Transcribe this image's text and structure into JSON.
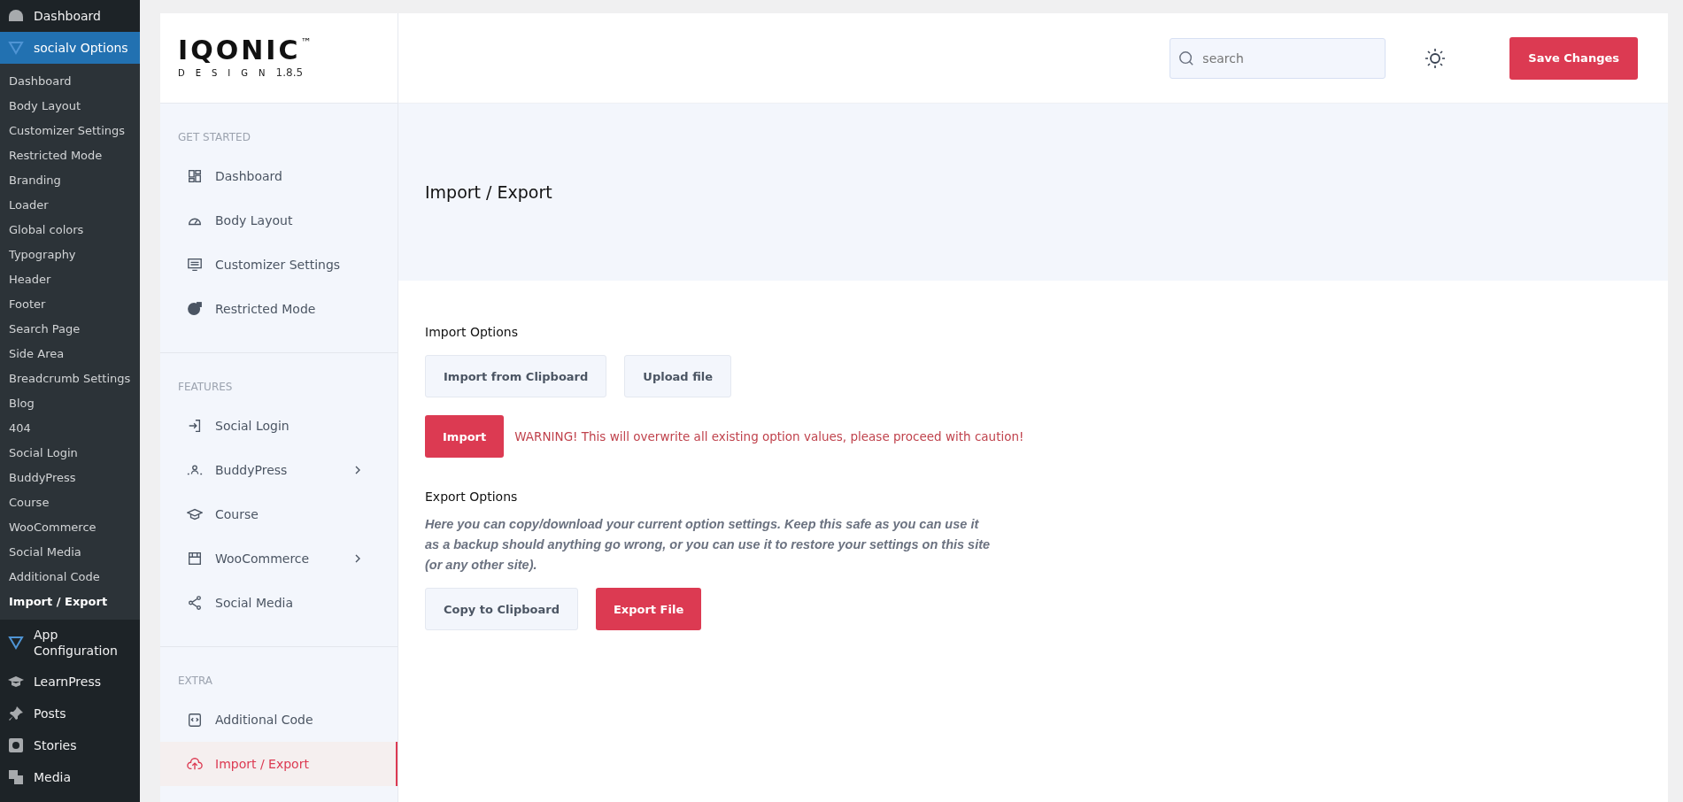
{
  "wp_menu": {
    "top": [
      {
        "label": "Dashboard",
        "selected": false
      },
      {
        "label": "socialv Options",
        "selected": true
      }
    ],
    "submenu": [
      {
        "label": "Dashboard",
        "selected": false
      },
      {
        "label": "Body Layout",
        "selected": false
      },
      {
        "label": "Customizer Settings",
        "selected": false
      },
      {
        "label": "Restricted Mode",
        "selected": false
      },
      {
        "label": "Branding",
        "selected": false
      },
      {
        "label": "Loader",
        "selected": false
      },
      {
        "label": "Global colors",
        "selected": false
      },
      {
        "label": "Typography",
        "selected": false
      },
      {
        "label": "Header",
        "selected": false
      },
      {
        "label": "Footer",
        "selected": false
      },
      {
        "label": "Search Page",
        "selected": false
      },
      {
        "label": "Side Area",
        "selected": false
      },
      {
        "label": "Breadcrumb Settings",
        "selected": false
      },
      {
        "label": "Blog",
        "selected": false
      },
      {
        "label": "404",
        "selected": false
      },
      {
        "label": "Social Login",
        "selected": false
      },
      {
        "label": "BuddyPress",
        "selected": false
      },
      {
        "label": "Course",
        "selected": false
      },
      {
        "label": "WooCommerce",
        "selected": false
      },
      {
        "label": "Social Media",
        "selected": false
      },
      {
        "label": "Additional Code",
        "selected": false
      },
      {
        "label": "Import / Export",
        "selected": true
      }
    ],
    "bottom": [
      {
        "label": "App Configuration",
        "selected": false
      },
      {
        "label": "LearnPress",
        "selected": false
      },
      {
        "label": "Posts",
        "selected": false
      },
      {
        "label": "Stories",
        "selected": false
      },
      {
        "label": "Media",
        "selected": false
      }
    ]
  },
  "logo": {
    "name": "IQONIC",
    "mark": "™",
    "sub": "DESIGN",
    "version": "1.8.5"
  },
  "search": {
    "placeholder": "search"
  },
  "save_button": "Save Changes",
  "sidebar": {
    "sections": [
      {
        "heading": "GET STARTED",
        "items": [
          {
            "label": "Dashboard",
            "expandable": false,
            "selected": false
          },
          {
            "label": "Body Layout",
            "expandable": false,
            "selected": false
          },
          {
            "label": "Customizer Settings",
            "expandable": false,
            "selected": false
          },
          {
            "label": "Restricted Mode",
            "expandable": false,
            "selected": false
          }
        ]
      },
      {
        "heading": "FEATURES",
        "items": [
          {
            "label": "Social Login",
            "expandable": false,
            "selected": false
          },
          {
            "label": "BuddyPress",
            "expandable": true,
            "selected": false
          },
          {
            "label": "Course",
            "expandable": false,
            "selected": false
          },
          {
            "label": "WooCommerce",
            "expandable": true,
            "selected": false
          },
          {
            "label": "Social Media",
            "expandable": false,
            "selected": false
          }
        ]
      },
      {
        "heading": "EXTRA",
        "items": [
          {
            "label": "Additional Code",
            "expandable": false,
            "selected": false
          },
          {
            "label": "Import / Export",
            "expandable": false,
            "selected": true
          }
        ]
      }
    ]
  },
  "page_title": "Import / Export",
  "import": {
    "heading": "Import Options",
    "buttons": [
      "Import from Clipboard",
      "Upload file"
    ],
    "import_button": "Import",
    "warning": "WARNING! This will overwrite all existing option values, please proceed with caution!"
  },
  "export": {
    "heading": "Export Options",
    "description": "Here you can copy/download your current option settings. Keep this safe as you can use it as a backup should anything go wrong, or you can use it to restore your settings on this site (or any other site).",
    "copy_button": "Copy to Clipboard",
    "export_button": "Export File"
  }
}
